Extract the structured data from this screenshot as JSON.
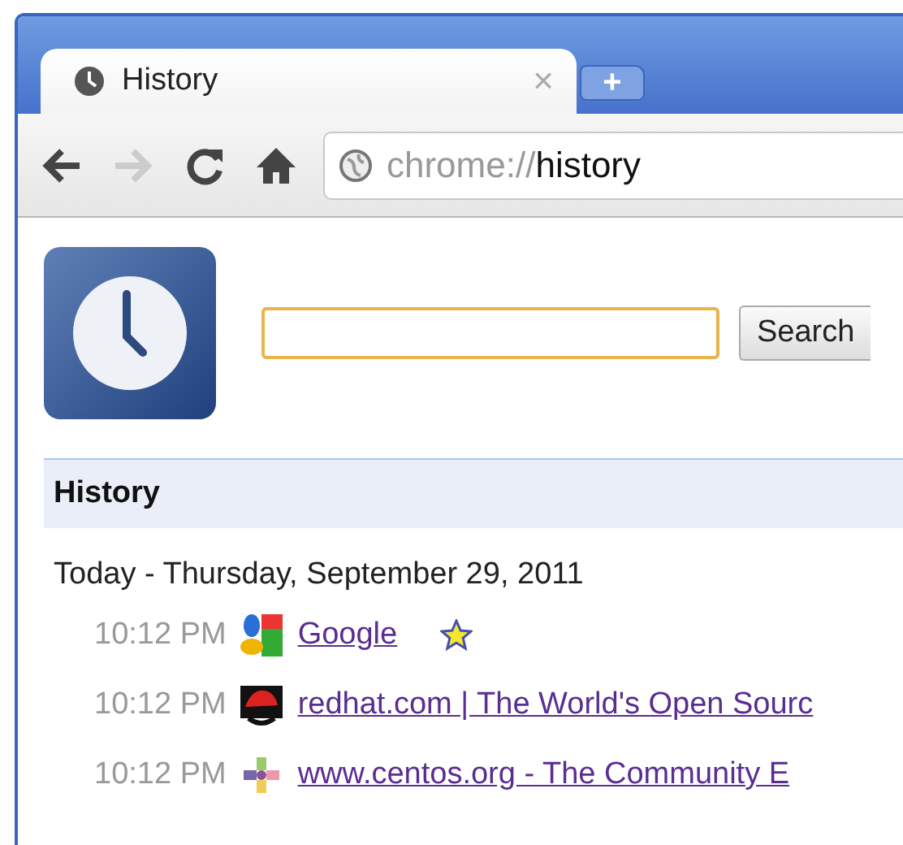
{
  "tabs": [
    {
      "title": "History",
      "selected": true,
      "close": "×"
    }
  ],
  "new_tab": "+",
  "toolbar": {
    "back_disabled": false,
    "forward_disabled": true
  },
  "address": {
    "scheme": "chrome://",
    "path": "history"
  },
  "search": {
    "button": "Search"
  },
  "section_title": "History",
  "day": "Today - Thursday, September 29, 2011",
  "entries": [
    {
      "time": "10:12 PM",
      "kind": "google",
      "title": "Google",
      "starred": true
    },
    {
      "time": "10:12 PM",
      "kind": "redhat",
      "title": "redhat.com | The World's Open Sourc",
      "starred": false
    },
    {
      "time": "10:12 PM",
      "kind": "centos",
      "title": "www.centos.org - The Community E",
      "starred": false
    }
  ]
}
